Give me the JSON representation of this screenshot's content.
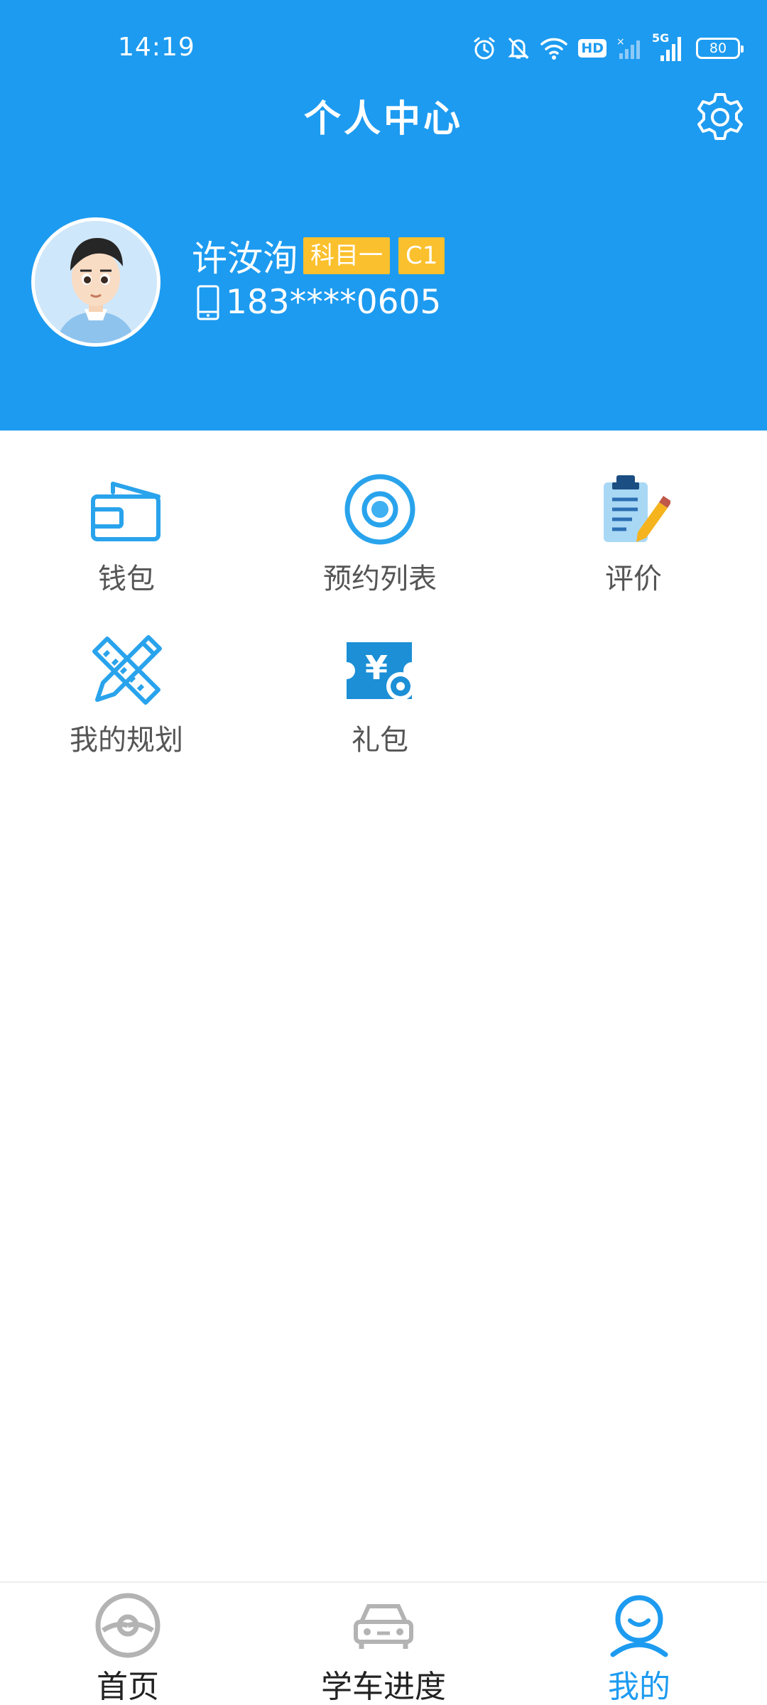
{
  "status_bar": {
    "time": "14:19",
    "hd_label": "HD",
    "network_label": "5G",
    "battery": "80",
    "icons": [
      "alarm-icon",
      "mute-icon",
      "wifi-icon",
      "hd-icon",
      "signal-weak-icon",
      "signal-5g-icon",
      "battery-icon"
    ]
  },
  "header": {
    "title": "个人中心",
    "settings_icon": "gear-icon",
    "background_color": "#1d9bf0"
  },
  "profile": {
    "name": "许汝洵",
    "badges": [
      "科目一",
      "C1"
    ],
    "badge_color": "#fbc02d",
    "phone_icon": "phone-icon",
    "phone": "183****0605"
  },
  "menu": {
    "items": [
      {
        "label": "钱包",
        "icon": "wallet-icon"
      },
      {
        "label": "预约列表",
        "icon": "target-icon"
      },
      {
        "label": "评价",
        "icon": "clipboard-pencil-icon"
      },
      {
        "label": "我的规划",
        "icon": "pencil-ruler-icon"
      },
      {
        "label": "礼包",
        "icon": "yen-ticket-icon"
      }
    ]
  },
  "bottom_nav": {
    "items": [
      {
        "label": "首页",
        "icon": "steering-wheel-icon",
        "active": false
      },
      {
        "label": "学车进度",
        "icon": "car-icon",
        "active": false
      },
      {
        "label": "我的",
        "icon": "user-icon",
        "active": true
      }
    ],
    "active_color": "#1d9bf0"
  }
}
